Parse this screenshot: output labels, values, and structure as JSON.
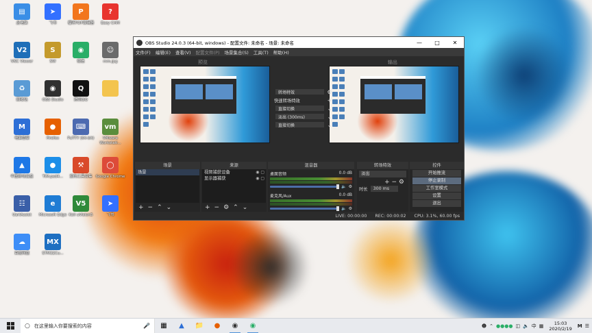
{
  "desktop": {
    "icons": [
      {
        "label": "此电脑",
        "icon": "computer-icon",
        "color": "#3a8ee6"
      },
      {
        "label": "飞书",
        "icon": "feishu-icon",
        "color": "#3370ff"
      },
      {
        "label": "福昕PDF编辑器",
        "icon": "pdf-icon",
        "color": "#f2761d"
      },
      {
        "label": "Easy CHM",
        "icon": "chm-icon",
        "color": "#e8342e"
      },
      {
        "label": "VNC Viewer",
        "icon": "vnc-icon",
        "color": "#1f6fb8"
      },
      {
        "label": "SW",
        "icon": "sw-icon",
        "color": "#c49a2c"
      },
      {
        "label": "微信",
        "icon": "wechat-icon",
        "color": "#2aae67"
      },
      {
        "label": "mm.jpg",
        "icon": "image-file-icon",
        "color": "#6b6b6b"
      },
      {
        "label": "回收站",
        "icon": "recycle-bin-icon",
        "color": "#5a9bd5"
      },
      {
        "label": "OBS Studio",
        "icon": "obs-icon",
        "color": "#303030"
      },
      {
        "label": "腾讯QQ",
        "icon": "qq-icon",
        "color": "#111111"
      },
      {
        "label": "",
        "icon": "folder-icon",
        "color": "#f3c44e"
      },
      {
        "label": "电脑管家",
        "icon": "pc-manager-icon",
        "color": "#2d6fd6"
      },
      {
        "label": "Firefox",
        "icon": "firefox-icon",
        "color": "#e66000"
      },
      {
        "label": "PuTTY (64-bit)",
        "icon": "putty-icon",
        "color": "#4c6ab0"
      },
      {
        "label": "VMware Workstati...",
        "icon": "vmware-icon",
        "color": "#5a8d3c"
      },
      {
        "label": "中国移动云盘",
        "icon": "cloud-drive-icon",
        "color": "#1e78e6"
      },
      {
        "label": "TIM.psd4...",
        "icon": "tim-icon",
        "color": "#1c8ee8"
      },
      {
        "label": "逆向工具合集",
        "icon": "tools-icon",
        "color": "#d94a2a"
      },
      {
        "label": "Google Chrome",
        "icon": "chrome-icon",
        "color": "#dd4b39"
      },
      {
        "label": "UartAssist",
        "icon": "uart-icon",
        "color": "#3a5fa8"
      },
      {
        "label": "Microsoft Edge",
        "icon": "edge-icon",
        "color": "#1f7cd4"
      },
      {
        "label": "Keil uVision5",
        "icon": "keil-icon",
        "color": "#2f8a3a"
      },
      {
        "label": "飞书",
        "icon": "lark-icon",
        "color": "#3370ff"
      },
      {
        "label": "百度网盘",
        "icon": "baidu-netdisk-icon",
        "color": "#3e8ef7"
      },
      {
        "label": "STM32Cu...",
        "icon": "stm32-icon",
        "color": "#1e6fc1"
      }
    ]
  },
  "obs": {
    "title": "OBS Studio 24.0.3 (64-bit, windows) - 配置文件: 未命名 - 场景: 未命名",
    "menu": [
      "文件(F)",
      "编辑(E)",
      "查看(V)",
      "配置文件(P)",
      "场景集合(S)",
      "工具(T)",
      "帮助(H)"
    ],
    "preview_label": "预览",
    "program_label": "输出",
    "transitions": {
      "transition_button": "转场特效",
      "quick_label": "快速转场特效",
      "items": [
        "直接切换",
        "淡出 (300ms)",
        "直接切换"
      ]
    },
    "docks": {
      "scenes": {
        "title": "场景",
        "items": [
          "场景"
        ]
      },
      "sources": {
        "title": "来源",
        "items": [
          "视频捕获设备",
          "显示器捕获"
        ]
      },
      "mixer": {
        "title": "混音器",
        "channels": [
          {
            "name": "桌面音频",
            "db": "0.0 dB"
          },
          {
            "name": "麦克风/Aux",
            "db": "0.0 dB"
          }
        ]
      },
      "scene_transitions": {
        "title": "转场特效",
        "selected": "淡出",
        "duration_label": "时长",
        "duration_value": "300 ms"
      },
      "controls": {
        "title": "控件",
        "buttons": [
          "开始推流",
          "停止录制",
          "工作室模式",
          "设置",
          "退出"
        ]
      }
    },
    "status": {
      "live": "LIVE: 00:00:00",
      "rec": "REC: 00:00:02",
      "cpu": "CPU: 3.1%, 60.00 fps"
    }
  },
  "taskbar": {
    "search_placeholder": "在这里输入你要搜索的内容",
    "time": "15:03",
    "date": "2020/2/19",
    "ime": "中",
    "accent": "#4a90d9"
  }
}
